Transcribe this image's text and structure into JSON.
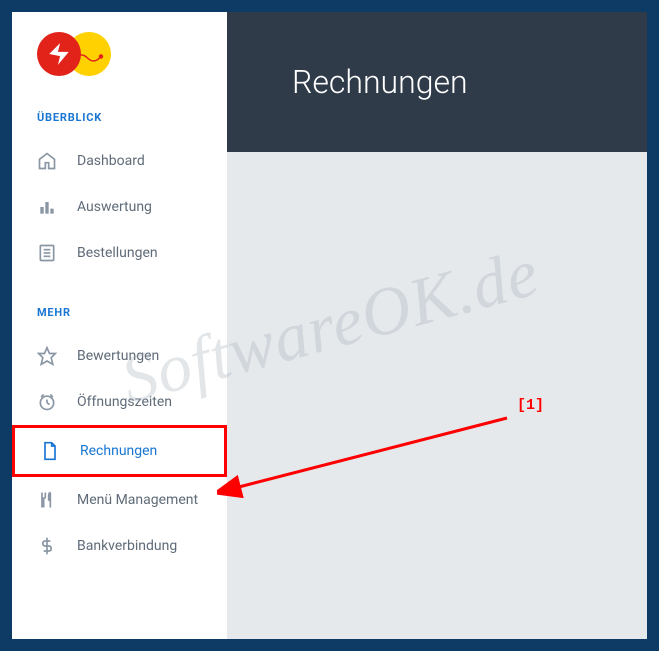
{
  "sidebar": {
    "section1_header": "ÜBERBLICK",
    "section2_header": "MEHR",
    "items1": [
      {
        "label": "Dashboard",
        "icon": "home"
      },
      {
        "label": "Auswertung",
        "icon": "chart"
      },
      {
        "label": "Bestellungen",
        "icon": "list"
      }
    ],
    "items2": [
      {
        "label": "Bewertungen",
        "icon": "star"
      },
      {
        "label": "Öffnungszeiten",
        "icon": "clock"
      },
      {
        "label": "Rechnungen",
        "icon": "document"
      },
      {
        "label": "Menü Management",
        "icon": "utensils"
      },
      {
        "label": "Bankverbindung",
        "icon": "dollar"
      }
    ]
  },
  "header": {
    "title": "Rechnungen"
  },
  "annotation": {
    "label": "[1]"
  },
  "watermark": "SoftwareOK.de"
}
